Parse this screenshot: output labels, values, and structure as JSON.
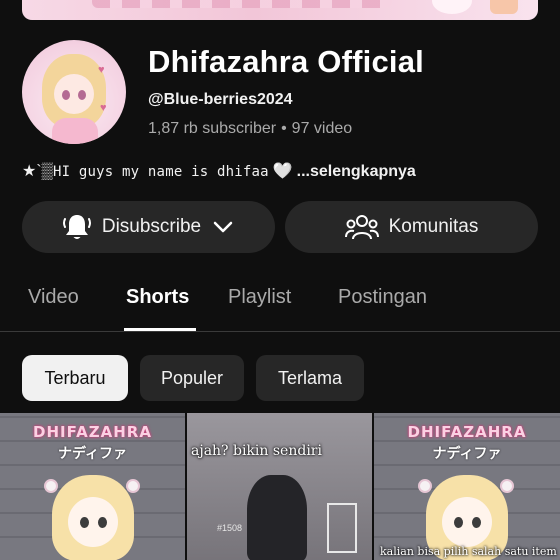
{
  "channel": {
    "name": "Dhifazahra Official",
    "handle": "@Blue-berries2024",
    "subscribers": "1,87 rb subscriber",
    "separator": "•",
    "videos": "97 video",
    "description_prefix": "★`▒",
    "description_text": "HI guys my name is dhifaa",
    "description_heart": "🤍",
    "description_more": "...selengkapnya"
  },
  "actions": {
    "subscribe_label": "Disubscribe",
    "community_label": "Komunitas"
  },
  "tabs": [
    {
      "label": "Video"
    },
    {
      "label": "Shorts",
      "active": true
    },
    {
      "label": "Playlist"
    },
    {
      "label": "Postingan"
    }
  ],
  "filters": [
    {
      "label": "Terbaru",
      "selected": true
    },
    {
      "label": "Populer"
    },
    {
      "label": "Terlama"
    }
  ],
  "shorts": [
    {
      "logo": "DHIFAZAHRA",
      "subtitle": "ナディファ"
    },
    {
      "caption": "ajah? bikin sendiri",
      "badge": "#1508"
    },
    {
      "logo": "DHIFAZAHRA",
      "subtitle": "ナディファ",
      "caption": "kalian bisa pilih salah satu item"
    }
  ],
  "colors": {
    "background": "#0f0f0f",
    "button": "#272727",
    "muted_text": "#aaaaaa",
    "accent_pink": "#f4c6d8"
  },
  "icons": {
    "bell": "bell-icon",
    "chevron": "chevron-down-icon",
    "community": "community-icon"
  }
}
